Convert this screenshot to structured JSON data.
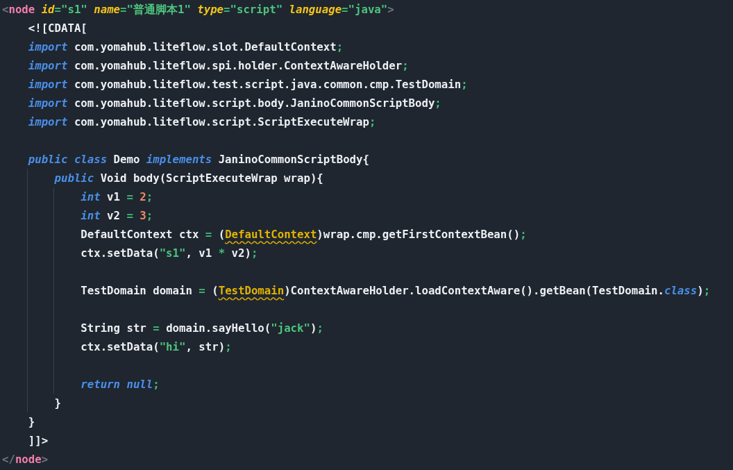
{
  "editor": {
    "lines": [
      {
        "tokens": [
          {
            "kind": "bracket",
            "text": "<"
          },
          {
            "kind": "tag",
            "text": "node"
          },
          {
            "kind": "attr",
            "text": " id"
          },
          {
            "kind": "punct",
            "text": "="
          },
          {
            "kind": "string",
            "text": "\"s1\""
          },
          {
            "kind": "attr",
            "text": " name"
          },
          {
            "kind": "punct",
            "text": "="
          },
          {
            "kind": "string",
            "text": "\"普通脚本1\""
          },
          {
            "kind": "attr",
            "text": " type"
          },
          {
            "kind": "punct",
            "text": "="
          },
          {
            "kind": "string",
            "text": "\"script\""
          },
          {
            "kind": "attr",
            "text": " language"
          },
          {
            "kind": "punct",
            "text": "="
          },
          {
            "kind": "string",
            "text": "\"java\""
          },
          {
            "kind": "bracket",
            "text": ">"
          }
        ],
        "children": [
          {
            "tokens": [
              {
                "kind": "plain",
                "text": "<![CDATA["
              }
            ]
          },
          {
            "tokens": [
              {
                "kind": "keyword",
                "text": "import"
              },
              {
                "kind": "plain",
                "text": " com.yomahub.liteflow.slot.DefaultContext"
              },
              {
                "kind": "punct",
                "text": ";"
              }
            ]
          },
          {
            "tokens": [
              {
                "kind": "keyword",
                "text": "import"
              },
              {
                "kind": "plain",
                "text": " com.yomahub.liteflow.spi.holder.ContextAwareHolder"
              },
              {
                "kind": "punct",
                "text": ";"
              }
            ]
          },
          {
            "tokens": [
              {
                "kind": "keyword",
                "text": "import"
              },
              {
                "kind": "plain",
                "text": " com.yomahub.liteflow.test.script.java.common.cmp.TestDomain"
              },
              {
                "kind": "punct",
                "text": ";"
              }
            ]
          },
          {
            "tokens": [
              {
                "kind": "keyword",
                "text": "import"
              },
              {
                "kind": "plain",
                "text": " com.yomahub.liteflow.script.body.JaninoCommonScriptBody"
              },
              {
                "kind": "punct",
                "text": ";"
              }
            ]
          },
          {
            "tokens": [
              {
                "kind": "keyword",
                "text": "import"
              },
              {
                "kind": "plain",
                "text": " com.yomahub.liteflow.script.ScriptExecuteWrap"
              },
              {
                "kind": "punct",
                "text": ";"
              }
            ]
          },
          {
            "kind": "blank"
          },
          {
            "tokens": [
              {
                "kind": "keyword",
                "text": "public class"
              },
              {
                "kind": "plain",
                "text": " Demo "
              },
              {
                "kind": "keyword",
                "text": "implements"
              },
              {
                "kind": "plain",
                "text": " JaninoCommonScriptBody{"
              }
            ],
            "children": [
              {
                "tokens": [
                  {
                    "kind": "keyword",
                    "text": "public"
                  },
                  {
                    "kind": "plain",
                    "text": " Void body(ScriptExecuteWrap wrap){"
                  }
                ],
                "children": [
                  {
                    "tokens": [
                      {
                        "kind": "keyword",
                        "text": "int"
                      },
                      {
                        "kind": "plain",
                        "text": " v1 "
                      },
                      {
                        "kind": "punct",
                        "text": "="
                      },
                      {
                        "kind": "number",
                        "text": " 2"
                      },
                      {
                        "kind": "punct",
                        "text": ";"
                      }
                    ]
                  },
                  {
                    "tokens": [
                      {
                        "kind": "keyword",
                        "text": "int"
                      },
                      {
                        "kind": "plain",
                        "text": " v2 "
                      },
                      {
                        "kind": "punct",
                        "text": "="
                      },
                      {
                        "kind": "number",
                        "text": " 3"
                      },
                      {
                        "kind": "punct",
                        "text": ";"
                      }
                    ]
                  },
                  {
                    "tokens": [
                      {
                        "kind": "plain",
                        "text": "DefaultContext ctx "
                      },
                      {
                        "kind": "punct",
                        "text": "="
                      },
                      {
                        "kind": "plain",
                        "text": " ("
                      },
                      {
                        "kind": "warning",
                        "text": "DefaultContext"
                      },
                      {
                        "kind": "plain",
                        "text": ")wrap.cmp.getFirstContextBean()"
                      },
                      {
                        "kind": "punct",
                        "text": ";"
                      }
                    ]
                  },
                  {
                    "tokens": [
                      {
                        "kind": "plain",
                        "text": "ctx.setData("
                      },
                      {
                        "kind": "string",
                        "text": "\"s1\""
                      },
                      {
                        "kind": "plain",
                        "text": ", v1 "
                      },
                      {
                        "kind": "punct",
                        "text": "*"
                      },
                      {
                        "kind": "plain",
                        "text": " v2)"
                      },
                      {
                        "kind": "punct",
                        "text": ";"
                      }
                    ]
                  },
                  {
                    "kind": "blank"
                  },
                  {
                    "tokens": [
                      {
                        "kind": "plain",
                        "text": "TestDomain domain "
                      },
                      {
                        "kind": "punct",
                        "text": "="
                      },
                      {
                        "kind": "plain",
                        "text": " ("
                      },
                      {
                        "kind": "warning",
                        "text": "TestDomain"
                      },
                      {
                        "kind": "plain",
                        "text": ")ContextAwareHolder.loadContextAware().getBean(TestDomain."
                      },
                      {
                        "kind": "keyword",
                        "text": "class"
                      },
                      {
                        "kind": "plain",
                        "text": ")"
                      },
                      {
                        "kind": "punct",
                        "text": ";"
                      }
                    ]
                  },
                  {
                    "kind": "blank"
                  },
                  {
                    "tokens": [
                      {
                        "kind": "plain",
                        "text": "String str "
                      },
                      {
                        "kind": "punct",
                        "text": "="
                      },
                      {
                        "kind": "plain",
                        "text": " domain.sayHello("
                      },
                      {
                        "kind": "string",
                        "text": "\"jack\""
                      },
                      {
                        "kind": "plain",
                        "text": ")"
                      },
                      {
                        "kind": "punct",
                        "text": ";"
                      }
                    ]
                  },
                  {
                    "tokens": [
                      {
                        "kind": "plain",
                        "text": "ctx.setData("
                      },
                      {
                        "kind": "string",
                        "text": "\"hi\""
                      },
                      {
                        "kind": "plain",
                        "text": ", str)"
                      },
                      {
                        "kind": "punct",
                        "text": ";"
                      }
                    ]
                  },
                  {
                    "kind": "blank"
                  },
                  {
                    "tokens": [
                      {
                        "kind": "keyword",
                        "text": "return null"
                      },
                      {
                        "kind": "punct",
                        "text": ";"
                      }
                    ]
                  }
                ]
              },
              {
                "tokens": [
                  {
                    "kind": "plain",
                    "text": "}"
                  }
                ]
              }
            ]
          },
          {
            "tokens": [
              {
                "kind": "plain",
                "text": "}"
              }
            ]
          },
          {
            "tokens": [
              {
                "kind": "plain",
                "text": "]]>"
              }
            ]
          }
        ]
      },
      {
        "tokens": [
          {
            "kind": "bracket",
            "text": "</"
          },
          {
            "kind": "tag",
            "text": "node"
          },
          {
            "kind": "bracket",
            "text": ">"
          }
        ]
      }
    ]
  }
}
